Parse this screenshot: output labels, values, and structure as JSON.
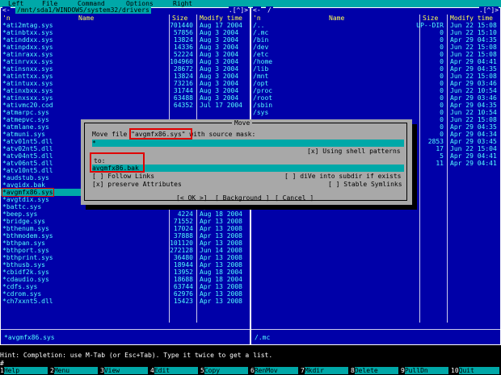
{
  "menu": [
    "Left",
    "File",
    "Command",
    "Options",
    "Right"
  ],
  "left_panel": {
    "path": "/mnt/sda1/WINDOWS/system32/drivers",
    "corner_left": "<-",
    "corner_right": ".[^]>",
    "headers": {
      "sort": "'n",
      "name": "Name",
      "size": "Size",
      "mtime": "Modify time"
    },
    "rows": [
      {
        "name": "*ati2mtag.sys",
        "size": "701440",
        "date": "Aug 17  2004"
      },
      {
        "name": "*atinbtxx.sys",
        "size": "57856",
        "date": "Aug  3  2004"
      },
      {
        "name": "*atinddxx.sys",
        "size": "13824",
        "date": "Aug  3  2004"
      },
      {
        "name": "*atinpdxx.sys",
        "size": "14336",
        "date": "Aug  3  2004"
      },
      {
        "name": "*atinraxx.sys",
        "size": "52224",
        "date": "Aug  3  2004"
      },
      {
        "name": "*atinrvxx.sys",
        "size": "104960",
        "date": "Aug  3  2004"
      },
      {
        "name": "*atinsnxx.sys",
        "size": "28672",
        "date": "Aug  3  2004"
      },
      {
        "name": "*atinttxx.sys",
        "size": "13824",
        "date": "Aug  3  2004"
      },
      {
        "name": "*atintuxx.sys",
        "size": "73216",
        "date": "Aug  3  2004"
      },
      {
        "name": "*atinxbxx.sys",
        "size": "31744",
        "date": "Aug  3  2004"
      },
      {
        "name": "*atinxsxx.sys",
        "size": "63488",
        "date": "Aug  3  2004"
      },
      {
        "name": "*ativmc20.cod",
        "size": "64352",
        "date": "Jul 17  2004"
      },
      {
        "name": "*atmarpc.sys",
        "size": "",
        "date": ""
      },
      {
        "name": "*atmepvc.sys",
        "size": "",
        "date": ""
      },
      {
        "name": "*atmlane.sys",
        "size": "",
        "date": ""
      },
      {
        "name": "*atmuni.sys",
        "size": "",
        "date": ""
      },
      {
        "name": "*atv01nt5.dll",
        "size": "",
        "date": ""
      },
      {
        "name": "*atv02nt5.dll",
        "size": "",
        "date": ""
      },
      {
        "name": "*atv04nt5.dll",
        "size": "",
        "date": ""
      },
      {
        "name": "*atv06nt5.dll",
        "size": "",
        "date": ""
      },
      {
        "name": "*atv10nt5.dll",
        "size": "",
        "date": ""
      },
      {
        "name": "*audstub.sys",
        "size": "",
        "date": ""
      },
      {
        "name": "*avgidx.bak",
        "size": "",
        "date": ""
      },
      {
        "name": "*avgmfx86.sys",
        "size": "",
        "date": ""
      },
      {
        "name": "*avgtdix.sys",
        "size": "",
        "date": ""
      },
      {
        "name": "*battc.sys",
        "size": "14208",
        "date": "Apr 13  2008"
      },
      {
        "name": "*beep.sys",
        "size": "4224",
        "date": "Aug 18  2004"
      },
      {
        "name": "*bridge.sys",
        "size": "71552",
        "date": "Apr 13  2008"
      },
      {
        "name": "*bthenum.sys",
        "size": "17024",
        "date": "Apr 13  2008"
      },
      {
        "name": "*bthmodem.sys",
        "size": "37888",
        "date": "Apr 13  2008"
      },
      {
        "name": "*bthpan.sys",
        "size": "101120",
        "date": "Apr 13  2008"
      },
      {
        "name": "*bthport.sys",
        "size": "272128",
        "date": "Jun 14  2008"
      },
      {
        "name": "*bthprint.sys",
        "size": "36480",
        "date": "Apr 13  2008"
      },
      {
        "name": "*bthusb.sys",
        "size": "18944",
        "date": "Apr 13  2008"
      },
      {
        "name": "*cbidf2k.sys",
        "size": "13952",
        "date": "Aug 18  2004"
      },
      {
        "name": "*cdaudio.sys",
        "size": "18688",
        "date": "Aug 18  2004"
      },
      {
        "name": "*cdfs.sys",
        "size": "63744",
        "date": "Apr 13  2008"
      },
      {
        "name": "*cdrom.sys",
        "size": "62976",
        "date": "Apr 13  2008"
      },
      {
        "name": "*ch7xxnt5.dll",
        "size": "15423",
        "date": "Apr 13  2008"
      }
    ],
    "footer": "*avgmfx86.sys"
  },
  "right_panel": {
    "path": "/",
    "corner_left": "<-",
    "corner_right": ".[^]>",
    "headers": {
      "sort": "'n",
      "name": "Name",
      "size": "Size",
      "mtime": "Modify time"
    },
    "rows": [
      {
        "name": "/..",
        "size": "UP--DIR",
        "date": "Jun 22 15:08"
      },
      {
        "name": "/.mc",
        "size": "0",
        "date": "Jun 22 15:10"
      },
      {
        "name": "/bin",
        "size": "0",
        "date": "Apr 29 04:35"
      },
      {
        "name": "/dev",
        "size": "0",
        "date": "Jun 22 15:08"
      },
      {
        "name": "/etc",
        "size": "0",
        "date": "Jun 22 15:08"
      },
      {
        "name": "/home",
        "size": "0",
        "date": "Apr 29 04:41"
      },
      {
        "name": "/lib",
        "size": "0",
        "date": "Apr 29 04:35"
      },
      {
        "name": "/mnt",
        "size": "0",
        "date": "Jun 22 15:08"
      },
      {
        "name": "/opt",
        "size": "0",
        "date": "Apr 29 03:46"
      },
      {
        "name": "/proc",
        "size": "0",
        "date": "Jun 22 10:54"
      },
      {
        "name": "/root",
        "size": "0",
        "date": "Apr 29 03:46"
      },
      {
        "name": "/sbin",
        "size": "0",
        "date": "Apr 29 04:35"
      },
      {
        "name": "/sys",
        "size": "0",
        "date": "Jun 22 10:54"
      },
      {
        "name": "",
        "size": "0",
        "date": "Jun 22 15:08"
      },
      {
        "name": "",
        "size": "0",
        "date": "Apr 29 04:35"
      },
      {
        "name": "",
        "size": "0",
        "date": "Apr 29 04:34"
      },
      {
        "name": "",
        "size": "2853",
        "date": "Apr 29 03:45"
      },
      {
        "name": "",
        "size": "17",
        "date": "Jun 22 15:04"
      },
      {
        "name": "",
        "size": "5",
        "date": "Apr 29 04:41"
      },
      {
        "name": "",
        "size": "11",
        "date": "Apr 29 04:41"
      }
    ],
    "footer": "/.mc"
  },
  "dialog": {
    "title": "Move",
    "prefix": "Move file ",
    "filename": "\"avgmfx86.sys\"",
    "suffix": " with source mask:",
    "mask": "*",
    "shell_patterns": "[x] Using shell patterns",
    "to_label": "to:",
    "to_value": "avgmfx86.bak_",
    "follow_links": "[ ] Follow Links",
    "dive_subdir": "[ ] diVe into subdir if exists",
    "preserve_attrs": "[x] preserve Attributes",
    "stable_symlinks": "[ ] Stable Symlinks",
    "ok": "[< OK >]",
    "background": "[ Background ]",
    "cancel": "[ Cancel ]"
  },
  "hint": "Hint: Completion: use M-Tab (or Esc+Tab).  Type it twice to get a list.",
  "prompt": "#",
  "keys": [
    {
      "num": "1",
      "label": "Help"
    },
    {
      "num": "2",
      "label": "Menu"
    },
    {
      "num": "3",
      "label": "View"
    },
    {
      "num": "4",
      "label": "Edit"
    },
    {
      "num": "5",
      "label": "Copy"
    },
    {
      "num": "6",
      "label": "RenMov"
    },
    {
      "num": "7",
      "label": "Mkdir"
    },
    {
      "num": "8",
      "label": "Delete"
    },
    {
      "num": "9",
      "label": "PullDn"
    },
    {
      "num": "10",
      "label": "Quit"
    }
  ],
  "colors": {
    "panel_bg": "#0000a8",
    "accent": "#00a8a8",
    "text": "#54ffff",
    "header": "#ffff54",
    "dialog_bg": "#a8a8a8",
    "highlight": "#e00000"
  }
}
